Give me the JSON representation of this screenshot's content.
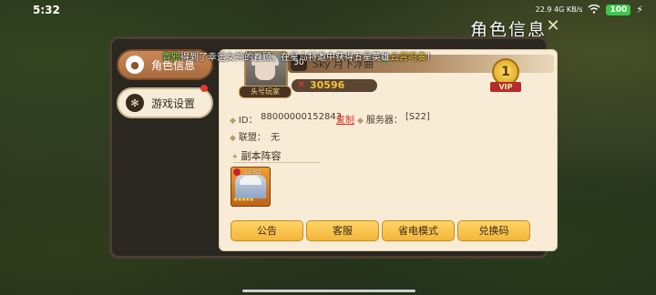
{
  "status_bar": {
    "time": "5:32",
    "network_speed": "22.9 4G KB/s",
    "battery": "100"
  },
  "page": {
    "title": "角色信息"
  },
  "tabs": [
    {
      "label": "角色信息",
      "active": true
    },
    {
      "label": "游戏设置",
      "active": false
    }
  ],
  "marquee": {
    "name": "青鸦",
    "text_mid": "得到了幸运女神的眷顾，在星岛特邀中获得五星英雄",
    "hero": "云霄鸣奏",
    "text_end": "！"
  },
  "player": {
    "level": "30",
    "name": "Sky 月下浮曲",
    "avatar_badge": "头号玩家",
    "power": "30596",
    "vip_level": "1",
    "vip_label": "VIP"
  },
  "info": {
    "id_label": "ID：",
    "id_value": "88000000152843",
    "copy_label": "复制",
    "server_label": "服务器：",
    "server_value": "[S22]",
    "alliance_label": "联盟：",
    "alliance_value": "无"
  },
  "lineup": {
    "title": "副本阵容",
    "heroes": [
      {
        "level": "Lv.82",
        "stars": "★★★★★"
      }
    ]
  },
  "buttons": {
    "notice": "公告",
    "service": "客服",
    "power_save": "省电模式",
    "redeem": "兑换码"
  },
  "colors": {
    "accent": "#f2b63a",
    "panel_bg": "#f8ecd6",
    "copy_link": "#d8352b",
    "marquee_name": "#7fe05a",
    "marquee_hero": "#ffd23a"
  }
}
